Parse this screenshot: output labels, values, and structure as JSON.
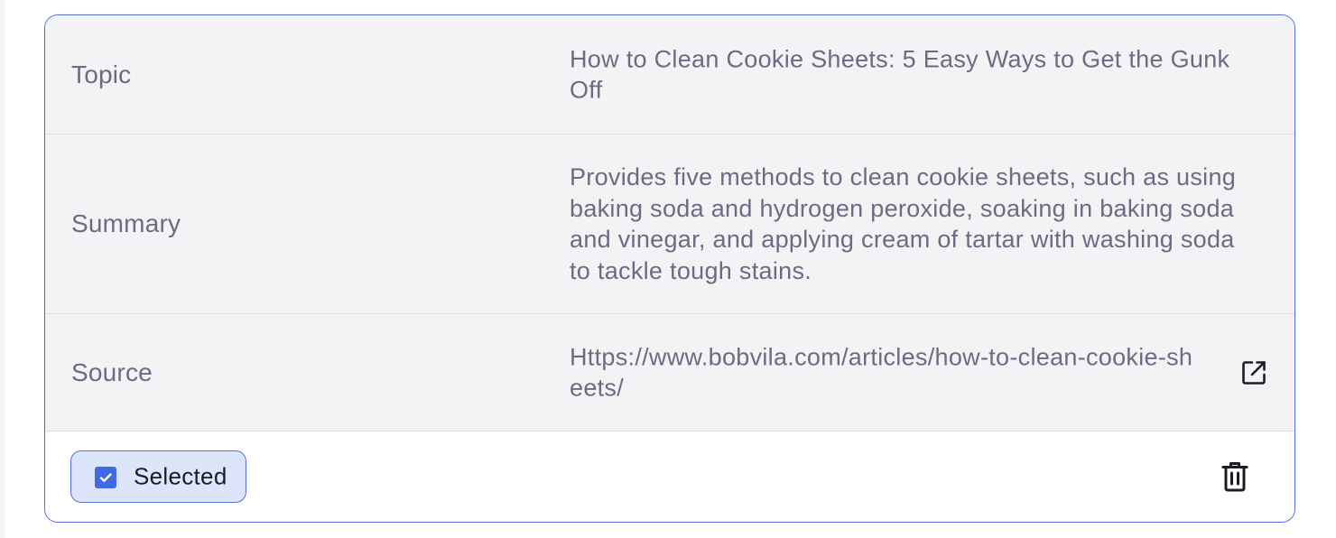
{
  "rows": [
    {
      "label": "Topic",
      "value": "How to Clean Cookie Sheets: 5 Easy Ways to Get the Gunk Off"
    },
    {
      "label": "Summary",
      "value": "Provides five methods to clean cookie sheets, such as using baking soda and hydrogen peroxide, soaking in baking soda and vinegar, and applying cream of tartar with washing soda to tackle tough stains."
    },
    {
      "label": "Source",
      "value": "Https://www.bobvila.com/articles/how-to-clean-cookie-sheets/",
      "action_icon": "external-link-icon"
    }
  ],
  "footer": {
    "selected_label": "Selected",
    "selected_checked": true,
    "delete_icon": "trash-icon"
  },
  "colors": {
    "accent": "#4f6fd8",
    "checkbox": "#3f6ae6",
    "chip_bg": "#dde5fb",
    "row_bg": "#f3f3f6",
    "text_muted": "#6b6b83"
  }
}
